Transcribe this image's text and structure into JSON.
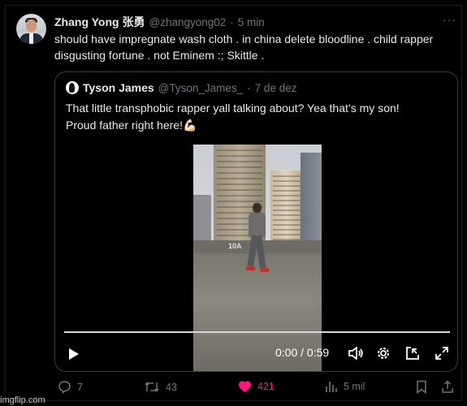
{
  "tweet": {
    "author_name": "Zhang Yong 张勇",
    "author_handle": "@zhangyong02",
    "separator": "·",
    "time": "5 min",
    "more_glyph": "···",
    "text": "should have impregnate wash cloth . in china delete bloodline . child rapper disgusting fortune . not Eminem :; Skittle ."
  },
  "quote": {
    "author_name": "Tyson James",
    "author_handle": "@Tyson_James_",
    "separator": "·",
    "date": "7 de dez",
    "text_line1": "That little transphobic rapper yall talking about? Yea that’s my son!",
    "text_line2": "Proud father right here!💪🏻",
    "video": {
      "time_label": "0:00 / 0:59",
      "sign_text": "10A",
      "progress": 0,
      "icons": [
        "play-icon",
        "volume-icon",
        "settings-icon",
        "picture-in-picture-icon",
        "fullscreen-icon"
      ]
    }
  },
  "actions": {
    "replies": "7",
    "reposts": "43",
    "likes": "421",
    "views": "5 mil",
    "like_color": "#f91880",
    "icons": [
      "reply-icon",
      "repost-icon",
      "like-icon",
      "views-icon",
      "bookmark-icon",
      "share-icon"
    ]
  },
  "watermark": "imgflip.com"
}
